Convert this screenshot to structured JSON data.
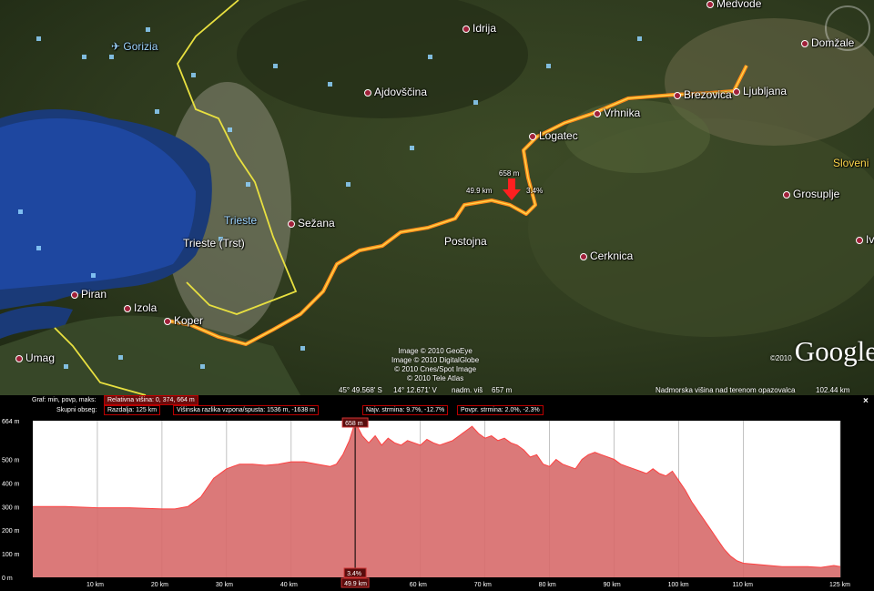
{
  "map": {
    "places": [
      {
        "id": "medvode",
        "label": "Medvode"
      },
      {
        "id": "gorizia",
        "label": "Gorizia"
      },
      {
        "id": "idrija",
        "label": "Idrija"
      },
      {
        "id": "domzale",
        "label": "Domžale"
      },
      {
        "id": "ajdovscina",
        "label": "Ajdovščina"
      },
      {
        "id": "brezovica",
        "label": "Brezovica"
      },
      {
        "id": "ljubljana",
        "label": "Ljubljana"
      },
      {
        "id": "vrhnika",
        "label": "Vrhnika"
      },
      {
        "id": "logatec",
        "label": "Logatec"
      },
      {
        "id": "slovenia",
        "label": "Sloveni"
      },
      {
        "id": "grosuplje",
        "label": "Grosuplje"
      },
      {
        "id": "trieste-it",
        "label": "Trieste"
      },
      {
        "id": "sezana",
        "label": "Sežana"
      },
      {
        "id": "trieste",
        "label": "Trieste (Trst)"
      },
      {
        "id": "postojna",
        "label": "Postojna"
      },
      {
        "id": "cerknica",
        "label": "Cerknica"
      },
      {
        "id": "piran",
        "label": "Piran"
      },
      {
        "id": "izola",
        "label": "Izola"
      },
      {
        "id": "koper",
        "label": "Koper"
      },
      {
        "id": "umag",
        "label": "Umag"
      },
      {
        "id": "iv",
        "label": "Iv"
      }
    ],
    "route_marker": {
      "elevation": "658 m",
      "distance": "49.9 km",
      "slope": "3.4%"
    },
    "credits": [
      "Image © 2010 GeoEye",
      "Image © 2010 DigitalGlobe",
      "© 2010 Cnes/Spot Image",
      "© 2010 Tele Atlas"
    ],
    "logo": "Google",
    "logo_year": "©2010",
    "status": {
      "lat": "45° 49.568' S",
      "lon": "14° 12.671' V",
      "alt_label": "nadm. viš",
      "alt": "657 m",
      "eye_label": "Nadmorska višina nad terenom opazovalca",
      "eye": "102.44 km"
    }
  },
  "panel": {
    "graph_label": "Graf: min, povp, maks:",
    "relative_height": "Relativna višina: 0, 374, 664 m",
    "total_label": "Skupni obseg:",
    "distance": "Razdalja: 125 km",
    "elev_diff": "Višinska razlika vzpona/spusta: 1536 m, -1638 m",
    "max_slope": "Najv. strmina: 9.7%, -12.7%",
    "avg_slope": "Povpr. strmina: 2.0%, -2.3%",
    "close": "×"
  },
  "chart_data": {
    "type": "area",
    "xlabel": "",
    "ylabel": "",
    "xlim": [
      0,
      125
    ],
    "ylim": [
      0,
      664
    ],
    "y_ticks": [
      "0 m",
      "100 m",
      "200 m",
      "300 m",
      "400 m",
      "500 m",
      "664 m"
    ],
    "x_ticks": [
      "10 km",
      "20 km",
      "30 km",
      "40 km",
      "50 km",
      "60 km",
      "70 km",
      "80 km",
      "90 km",
      "100 km",
      "110 km",
      "125 km"
    ],
    "marker": {
      "x": 49.9,
      "x_label": "49.9 km",
      "y_label": "658 m",
      "slope_label": "3.4%"
    },
    "series": [
      {
        "x": [
          0,
          5,
          10,
          15,
          20,
          22,
          24,
          26,
          28,
          30,
          32,
          34,
          36,
          38,
          40,
          42,
          44,
          46,
          47,
          48,
          49,
          49.9,
          51,
          52,
          53,
          54,
          55,
          56,
          57,
          58,
          59,
          60,
          61,
          62,
          63,
          64,
          65,
          66,
          67,
          68,
          69,
          70,
          71,
          72,
          73,
          74,
          75,
          76,
          77,
          78,
          79,
          80,
          81,
          82,
          83,
          84,
          85,
          86,
          87,
          88,
          89,
          90,
          91,
          92,
          93,
          94,
          95,
          96,
          97,
          98,
          99,
          100,
          101,
          102,
          103,
          104,
          105,
          106,
          107,
          108,
          109,
          110,
          112,
          114,
          116,
          118,
          120,
          122,
          124,
          125
        ],
        "y": [
          300,
          300,
          295,
          295,
          290,
          290,
          300,
          340,
          420,
          460,
          480,
          480,
          475,
          480,
          490,
          490,
          480,
          470,
          480,
          520,
          580,
          658,
          600,
          570,
          600,
          560,
          590,
          570,
          560,
          580,
          570,
          560,
          585,
          570,
          560,
          570,
          580,
          600,
          620,
          640,
          610,
          590,
          600,
          580,
          590,
          570,
          560,
          540,
          510,
          520,
          480,
          470,
          500,
          480,
          470,
          460,
          500,
          520,
          530,
          520,
          510,
          500,
          480,
          470,
          460,
          450,
          440,
          460,
          440,
          430,
          450,
          410,
          370,
          320,
          280,
          240,
          200,
          160,
          120,
          90,
          70,
          60,
          55,
          50,
          45,
          45,
          45,
          42,
          50,
          45
        ]
      }
    ]
  },
  "colors": {
    "route": "#ff8c1a",
    "route_core": "#ffd84d",
    "border": "#e8e040",
    "area_fill": "#d76a6a",
    "area_line": "#ff4040",
    "marker": "#ff2020"
  }
}
